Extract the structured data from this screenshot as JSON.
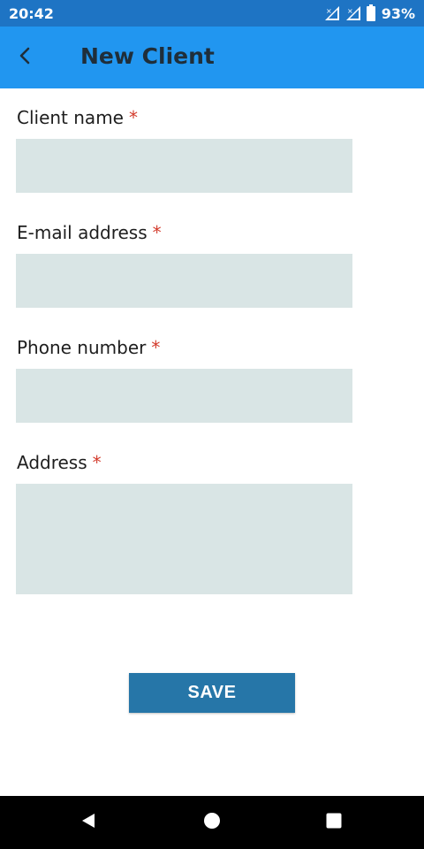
{
  "status_bar": {
    "time": "20:42",
    "battery": "93%",
    "icons": [
      "signal-icon-sim1",
      "signal-icon-sim2",
      "battery-icon"
    ]
  },
  "app_bar": {
    "title": "New Client",
    "back_icon": "chevron-left-icon",
    "color": "#2196f0"
  },
  "form": {
    "fields": [
      {
        "label": "Client name",
        "required": "*",
        "value": ""
      },
      {
        "label": "E-mail address",
        "required": "*",
        "value": ""
      },
      {
        "label": "Phone number",
        "required": "*",
        "value": ""
      },
      {
        "label": "Address",
        "required": "*",
        "value": ""
      }
    ],
    "save_label": "SAVE"
  },
  "nav_bar": {
    "icons": [
      "back-triangle-icon",
      "home-circle-icon",
      "recents-square-icon"
    ]
  },
  "colors": {
    "status_bar": "#1e74c4",
    "app_bar": "#2196f0",
    "input_fill": "#d9e5e5",
    "save_button": "#2676a8",
    "required": "#d33b2c"
  }
}
